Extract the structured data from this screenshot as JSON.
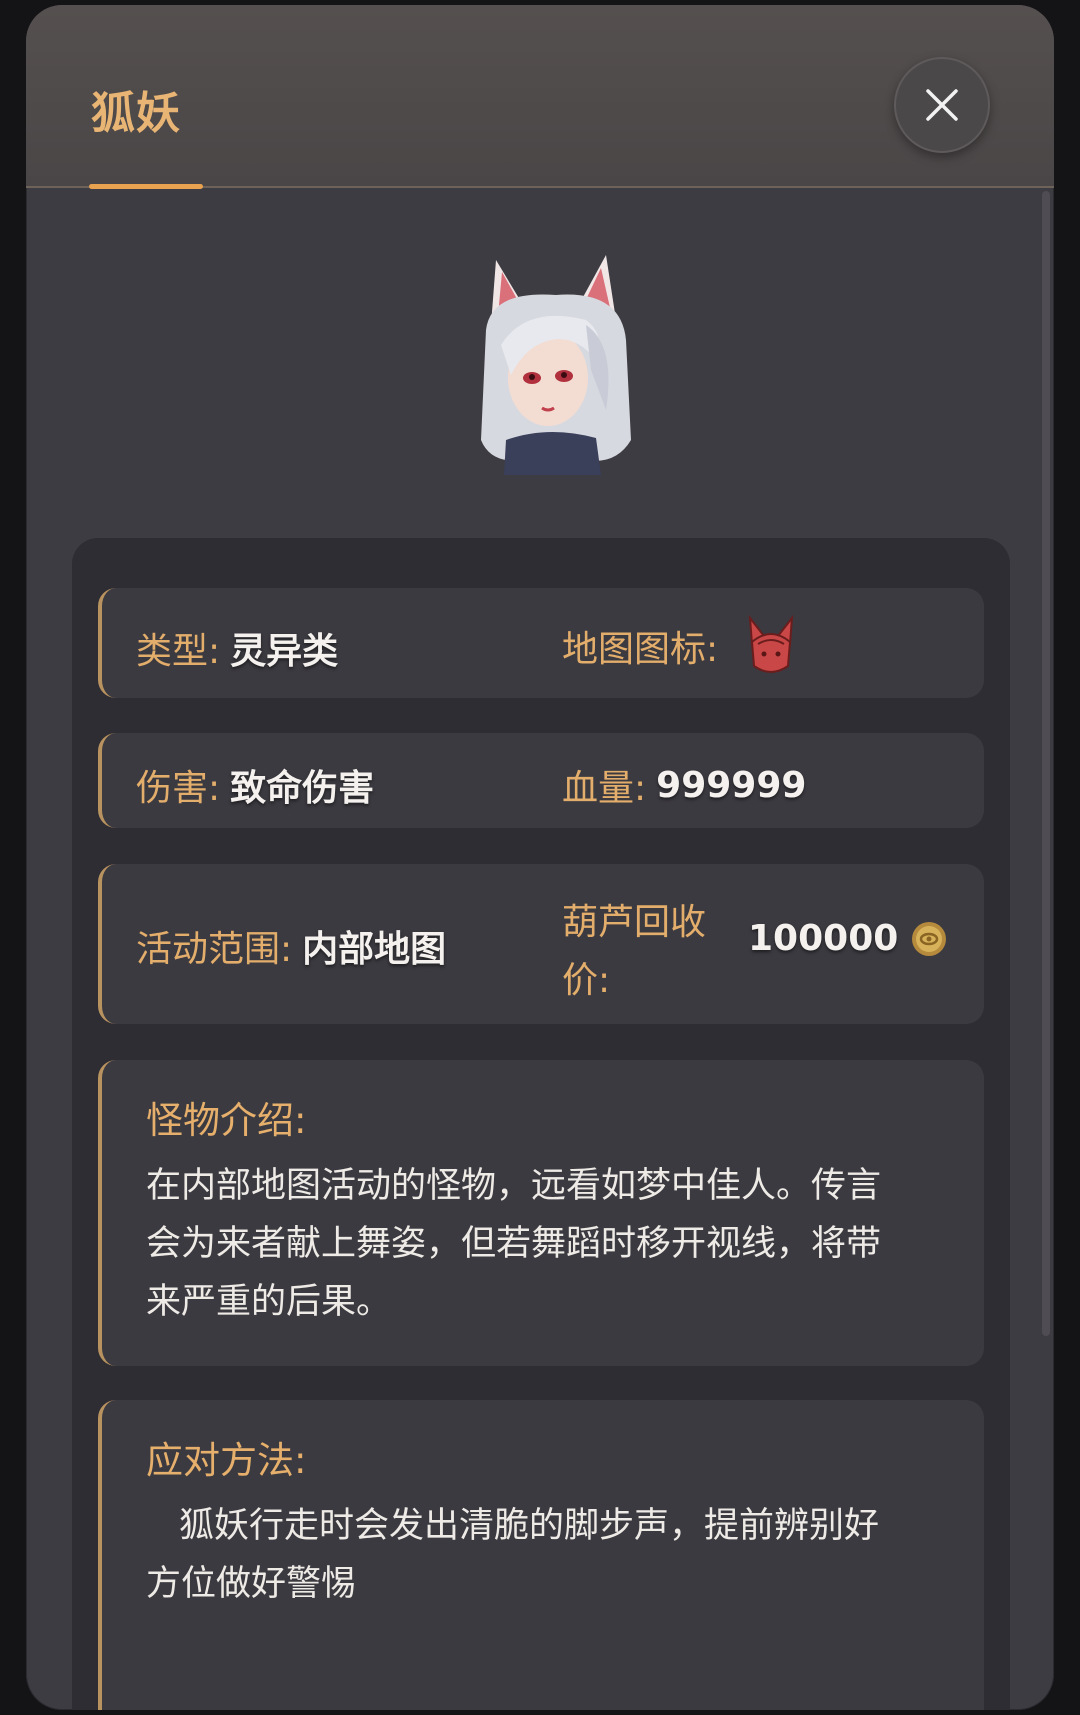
{
  "header": {
    "title": "狐妖",
    "close_icon": "close-icon"
  },
  "monster": {
    "portrait_icon": "fox-demon-portrait"
  },
  "stats": {
    "type_label": "类型:",
    "type_value": "灵异类",
    "map_icon_label": "地图图标:",
    "map_icon": "fox-head-map-icon",
    "damage_label": "伤害:",
    "damage_value": "致命伤害",
    "hp_label": "血量:",
    "hp_value": "999999",
    "range_label": "活动范围:",
    "range_value": "内部地图",
    "recycle_label_line1": "葫芦回收",
    "recycle_label_line2": "价:",
    "recycle_value": "100000",
    "coin_icon": "gold-coin-icon"
  },
  "intro": {
    "title": "怪物介绍:",
    "line1": "在内部地图活动的怪物，远看如梦中佳人。传言",
    "line2": "会为来者献上舞姿，但若舞蹈时移开视线，将带",
    "line3": "来严重的后果。"
  },
  "strategy": {
    "title": "应对方法:",
    "line1": "狐妖行走时会发出清脆的脚步声，提前辨别好",
    "line2": "方位做好警惕"
  },
  "colors": {
    "accent": "#e9b574",
    "card_border": "#b8925f",
    "panel_bg": "#2e2d33",
    "modal_bg": "#3d3c42"
  }
}
